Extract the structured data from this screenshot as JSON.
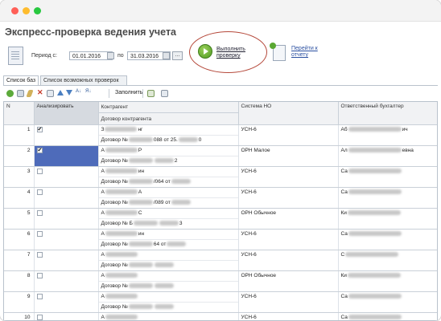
{
  "window": {
    "title": "Экспресс-проверка ведения учета"
  },
  "period": {
    "label_from": "Период с:",
    "date_from": "01.01.2016",
    "label_to": "по",
    "date_to": "31.03.2016",
    "dots": "..."
  },
  "actions": {
    "run_label": "Выполнить проверку",
    "goto_label": "Перейти к отчету"
  },
  "tabs": [
    {
      "label": "Список баз",
      "active": true
    },
    {
      "label": "Список возможных проверок",
      "active": false
    }
  ],
  "toolbar": {
    "fill_label": "Заполнить"
  },
  "colors": {
    "accent_circle": "#b5483a",
    "selection": "#4e6bba",
    "run_green": "#5aa832"
  },
  "table": {
    "headers": {
      "n": "N",
      "analyze": "Анализировать",
      "counterparty": "Контрагент",
      "contract": "Договор контрагента",
      "tax": "Система НО",
      "accountant": "Ответственный бухгалтер"
    },
    "rows": [
      {
        "n": "1",
        "checked": true,
        "cp": "З",
        "cp_tail": "нг",
        "contract": "Договор №",
        "c_mid": "088 от 25.",
        "c_end": "0",
        "tax": "УСН-6",
        "acc": "Аб",
        "acc_tail": "ич"
      },
      {
        "n": "2",
        "checked": true,
        "cp": "А",
        "cp_tail": "Р",
        "contract": "Договор №",
        "c_mid": "",
        "c_end": "2",
        "tax": "ОРН Малое",
        "acc": "Ал",
        "acc_tail": "евна"
      },
      {
        "n": "3",
        "checked": false,
        "cp": "А",
        "cp_tail": "ин",
        "contract": "Договор №",
        "c_mid": "/064 от",
        "c_end": "",
        "tax": "УСН-6",
        "acc": "Са",
        "acc_tail": ""
      },
      {
        "n": "4",
        "checked": false,
        "cp": "А",
        "cp_tail": "А",
        "contract": "Договор №",
        "c_mid": "/089 от",
        "c_end": "",
        "tax": "УСН-6",
        "acc": "Са",
        "acc_tail": ""
      },
      {
        "n": "5",
        "checked": false,
        "cp": "А",
        "cp_tail": "С",
        "contract": "Договор № Б",
        "c_mid": "",
        "c_end": "3",
        "tax": "ОРН Обычное",
        "acc": "Ки",
        "acc_tail": ""
      },
      {
        "n": "6",
        "checked": false,
        "cp": "А",
        "cp_tail": "ин",
        "contract": "Договор №",
        "c_mid": "64 от",
        "c_end": "",
        "tax": "УСН-6",
        "acc": "Са",
        "acc_tail": ""
      },
      {
        "n": "7",
        "checked": false,
        "cp": "А",
        "cp_tail": "",
        "contract": "Договор №",
        "c_mid": "",
        "c_end": "",
        "tax": "УСН-6",
        "acc": "С",
        "acc_tail": ""
      },
      {
        "n": "8",
        "checked": false,
        "cp": "А",
        "cp_tail": "",
        "contract": "Договор №",
        "c_mid": "",
        "c_end": "",
        "tax": "ОРН Обычное",
        "acc": "Ки",
        "acc_tail": ""
      },
      {
        "n": "9",
        "checked": false,
        "cp": "А",
        "cp_tail": "",
        "contract": "Договор №",
        "c_mid": "",
        "c_end": "",
        "tax": "УСН-6",
        "acc": "Са",
        "acc_tail": ""
      },
      {
        "n": "10",
        "checked": false,
        "cp": "А",
        "cp_tail": "",
        "contract": "Договор №",
        "c_mid": "",
        "c_end": "",
        "tax": "УСН-6",
        "acc": "Са",
        "acc_tail": ""
      }
    ]
  }
}
